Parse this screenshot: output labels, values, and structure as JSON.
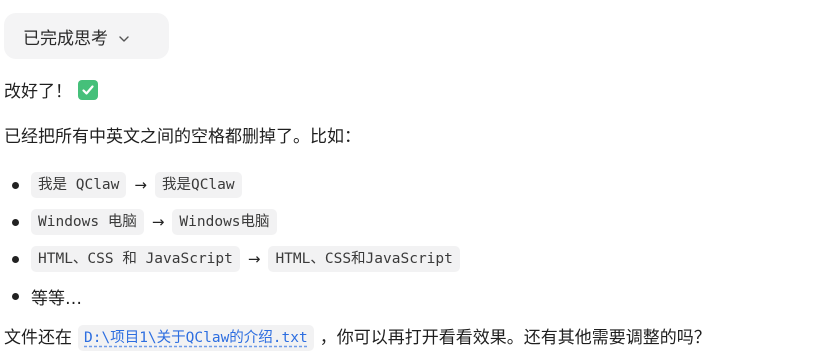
{
  "thinking": {
    "label": "已完成思考"
  },
  "message": {
    "greeting": "改好了！",
    "intro": "已经把所有中英文之间的空格都删掉了。比如：",
    "examples": [
      {
        "before": "我是 QClaw",
        "arrow": "→",
        "after": "我是QClaw"
      },
      {
        "before": "Windows 电脑",
        "arrow": "→",
        "after": "Windows电脑"
      },
      {
        "before": "HTML、CSS 和 JavaScript",
        "arrow": "→",
        "after": "HTML、CSS和JavaScript"
      }
    ],
    "etc": "等等…",
    "file_prefix": "文件还在",
    "file_path": "D:\\项目1\\关于QClaw的介绍.txt",
    "file_suffix": "，你可以再打开看看效果。还有其他需要调整的吗？"
  },
  "icons": {
    "check": "check-mark-icon",
    "chevron": "chevron-down-icon"
  },
  "colors": {
    "check_bg": "#45c07a",
    "link": "#2d6ee0",
    "chip_bg": "#f2f2f3",
    "pill_bg": "#f4f4f5"
  }
}
